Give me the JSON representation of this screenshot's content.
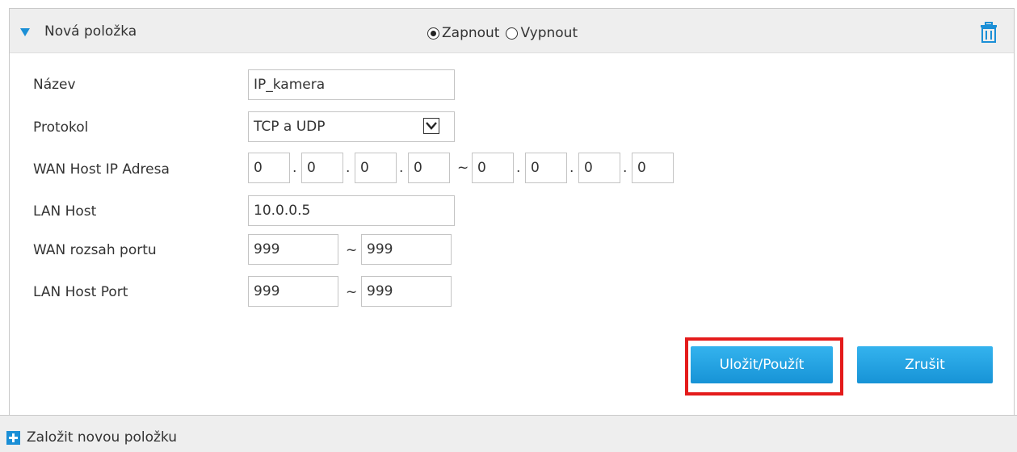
{
  "header": {
    "title": "Nová položka",
    "radio_on": "Zapnout",
    "radio_off": "Vypnout",
    "radio_selected": "Zapnout"
  },
  "form": {
    "name_label": "Název",
    "name_value": "IP_kamera",
    "protocol_label": "Protokol",
    "protocol_value": "TCP a UDP",
    "wan_ip_label": "WAN Host IP Adresa",
    "wan_ip_start": [
      "0",
      "0",
      "0",
      "0"
    ],
    "wan_ip_end": [
      "0",
      "0",
      "0",
      "0"
    ],
    "lan_host_label": "LAN Host",
    "lan_host_value": "10.0.0.5",
    "wan_port_label": "WAN rozsah portu",
    "wan_port_start": "999",
    "wan_port_end": "999",
    "lan_port_label": "LAN Host Port",
    "lan_port_start": "999",
    "lan_port_end": "999",
    "dot": ".",
    "tilde": "~"
  },
  "buttons": {
    "save": "Uložit/Použít",
    "cancel": "Zrušit"
  },
  "footer": {
    "add_new": "Založit novou položku"
  },
  "colors": {
    "accent": "#1b8fd6",
    "button": "#28a6e6",
    "highlight": "#e41b1b",
    "header_bg": "#eeeeee"
  },
  "icons": {
    "collapse": "triangle-down-icon",
    "delete": "trash-icon",
    "add": "plus-icon"
  }
}
